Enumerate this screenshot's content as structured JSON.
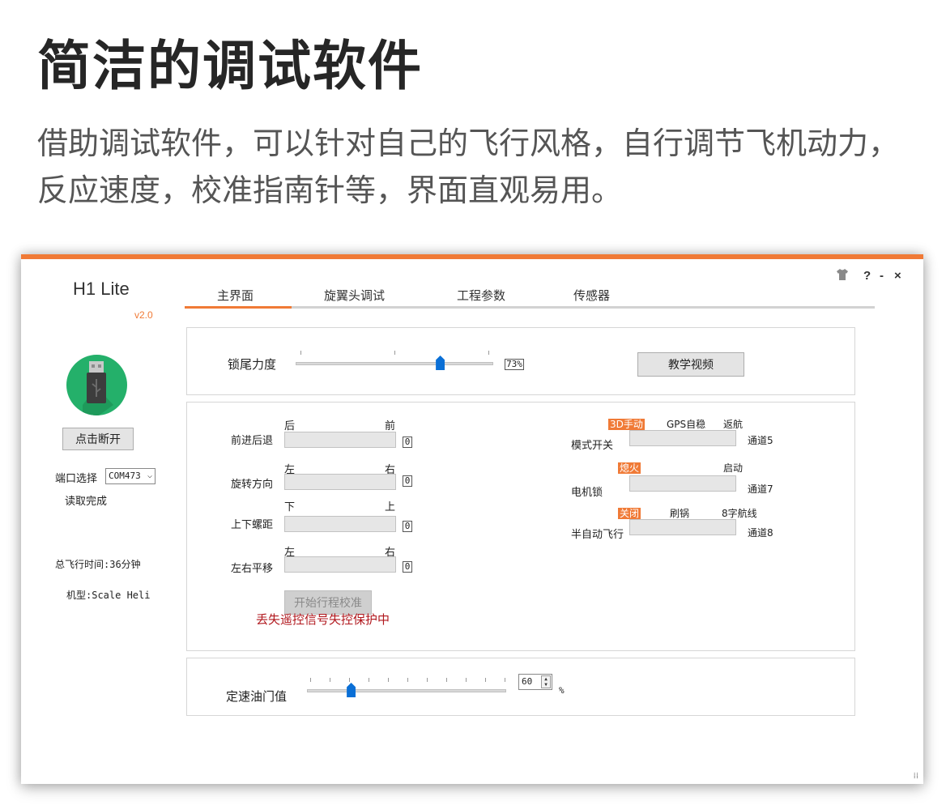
{
  "headline": "简洁的调试软件",
  "description": {
    "line1": "借助调试软件，可以针对自己的飞行风格，自行调节飞机动力，",
    "line2": "反应速度，校准指南针等，界面直观易用。"
  },
  "app": {
    "title": "H1 Lite",
    "version": "v2.0"
  },
  "window_controls": {
    "shirt_icon": "shirt-icon",
    "help": "?",
    "minimize": "-",
    "close": "×"
  },
  "sidebar": {
    "disconnect_button": "点击断开",
    "port_label": "端口选择",
    "port_value": "COM473",
    "read_status": "读取完成",
    "flight_time": "总飞行时间:36分钟",
    "model": "机型:Scale Heli"
  },
  "tabs": [
    {
      "label": "主界面",
      "active": true
    },
    {
      "label": "旋翼头调试",
      "active": false
    },
    {
      "label": "工程参数",
      "active": false
    },
    {
      "label": "传感器",
      "active": false
    }
  ],
  "tail_lock": {
    "label": "锁尾力度",
    "value": "73%",
    "level": 0.73,
    "tutorial_button": "教学视频"
  },
  "sticks": [
    {
      "name": "前进后退",
      "min_label": "后",
      "max_label": "前",
      "value": "0"
    },
    {
      "name": "旋转方向",
      "min_label": "左",
      "max_label": "右",
      "value": "0"
    },
    {
      "name": "上下螺距",
      "min_label": "下",
      "max_label": "上",
      "value": "0"
    },
    {
      "name": "左右平移",
      "min_label": "左",
      "max_label": "右",
      "value": "0"
    }
  ],
  "calibrate_button": "开始行程校准",
  "failsafe_warning": "丢失遥控信号失控保护中",
  "switches": [
    {
      "name": "模式开关",
      "channel": "通道5",
      "options": [
        "3D手动",
        "GPS自稳",
        "返航"
      ],
      "active": 0
    },
    {
      "name": "电机锁",
      "channel": "通道7",
      "options": [
        "熄火",
        "启动"
      ],
      "active": 0
    },
    {
      "name": "半自动飞行",
      "channel": "通道8",
      "options": [
        "关闭",
        "刷锅",
        "8字航线"
      ],
      "active": 0
    }
  ],
  "throttle": {
    "label": "定速油门值",
    "value": "60",
    "unit": "%",
    "level": 0.22
  },
  "colors": {
    "accent": "#f07a36",
    "usb_green": "#24b06a",
    "slider_blue": "#0a6fd6",
    "warning_red": "#b0161c"
  }
}
